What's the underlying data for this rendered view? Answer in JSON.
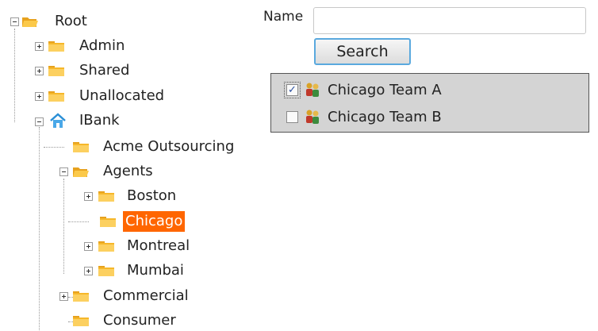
{
  "tree": {
    "root": "Root",
    "admin": "Admin",
    "shared": "Shared",
    "unallocated": "Unallocated",
    "ibank": "IBank",
    "acme": "Acme Outsourcing",
    "agents": "Agents",
    "boston": "Boston",
    "chicago": "Chicago",
    "montreal": "Montreal",
    "mumbai": "Mumbai",
    "commercial": "Commercial",
    "consumer": "Consumer"
  },
  "search": {
    "name_label": "Name",
    "name_value": "",
    "button_label": "Search"
  },
  "results": [
    {
      "label": "Chicago Team A",
      "checked": true
    },
    {
      "label": "Chicago Team B",
      "checked": false
    }
  ],
  "colors": {
    "selected_bg": "#ff6600",
    "folder": "#f6b72a",
    "button_border": "#5aa9de"
  }
}
